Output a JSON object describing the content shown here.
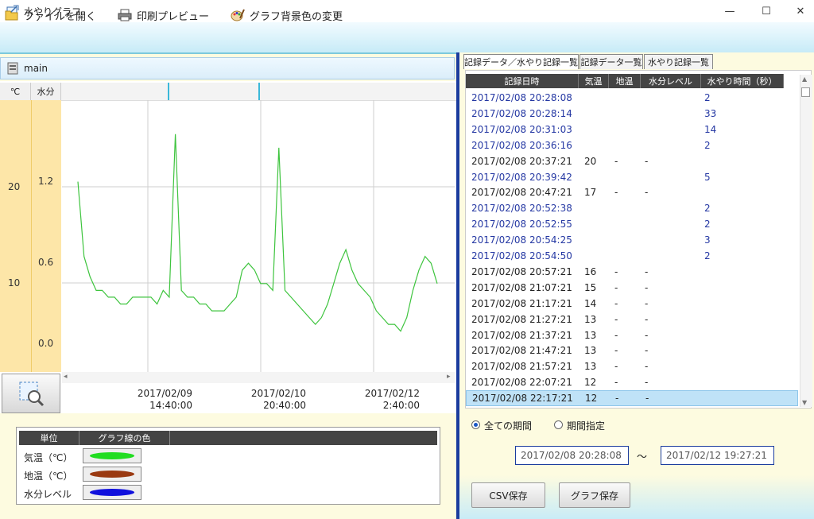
{
  "window": {
    "title": "水やりグラフ",
    "minimize": "—",
    "maximize": "☐",
    "close": "✕"
  },
  "toolbar": {
    "open_file": "ファイルを開く",
    "print_preview": "印刷プレビュー",
    "bg_color": "グラフ背景色の変更"
  },
  "left": {
    "panel_title": "main",
    "col_temp": "℃",
    "col_water": "水分"
  },
  "chart_data": {
    "type": "line",
    "y_temp_ticks": [
      "20",
      "10"
    ],
    "y_water_ticks": [
      "1.2",
      "0.6",
      "0.0"
    ],
    "x_ticks": [
      {
        "date": "2017/02/09",
        "time": "14:40:00"
      },
      {
        "date": "2017/02/10",
        "time": "20:40:00"
      },
      {
        "date": "2017/02/12",
        "time": "2:40:00"
      }
    ],
    "ylim_water": [
      -0.2,
      1.8
    ],
    "series": [
      {
        "color": "#3ec43e",
        "values": [
          1.2,
          0.65,
          0.5,
          0.4,
          0.4,
          0.35,
          0.35,
          0.3,
          0.3,
          0.35,
          0.35,
          0.35,
          0.35,
          0.3,
          0.4,
          0.35,
          1.55,
          0.4,
          0.35,
          0.35,
          0.3,
          0.3,
          0.25,
          0.25,
          0.25,
          0.3,
          0.35,
          0.55,
          0.6,
          0.55,
          0.45,
          0.45,
          0.4,
          1.45,
          0.4,
          0.35,
          0.3,
          0.25,
          0.2,
          0.15,
          0.2,
          0.3,
          0.45,
          0.6,
          0.7,
          0.55,
          0.45,
          0.4,
          0.35,
          0.25,
          0.2,
          0.15,
          0.15,
          0.1,
          0.2,
          0.4,
          0.55,
          0.65,
          0.6,
          0.45
        ]
      }
    ]
  },
  "legend": {
    "head_unit": "単位",
    "head_color": "グラフ線の色",
    "rows": [
      {
        "label": "気温（℃）",
        "color": "#22dd22"
      },
      {
        "label": "地温（℃）",
        "color": "#9a3a12"
      },
      {
        "label": "水分レベル",
        "color": "#1111dd"
      }
    ]
  },
  "right": {
    "tabs": [
      "記録データ／水やり記録一覧",
      "記録データ一覧",
      "水やり記録一覧"
    ],
    "headers": [
      "記録日時",
      "気温",
      "地温",
      "水分レベル",
      "水やり時間（秒）"
    ],
    "rows": [
      {
        "datetime": "2017/02/08 20:28:08",
        "temp": "",
        "soil": "",
        "level": "",
        "water": "2",
        "type": "water"
      },
      {
        "datetime": "2017/02/08 20:28:14",
        "temp": "",
        "soil": "",
        "level": "",
        "water": "33",
        "type": "water"
      },
      {
        "datetime": "2017/02/08 20:31:03",
        "temp": "",
        "soil": "",
        "level": "",
        "water": "14",
        "type": "water"
      },
      {
        "datetime": "2017/02/08 20:36:16",
        "temp": "",
        "soil": "",
        "level": "",
        "water": "2",
        "type": "water"
      },
      {
        "datetime": "2017/02/08 20:37:21",
        "temp": "20",
        "soil": "-",
        "level": "-",
        "water": "",
        "type": "record"
      },
      {
        "datetime": "2017/02/08 20:39:42",
        "temp": "",
        "soil": "",
        "level": "",
        "water": "5",
        "type": "water"
      },
      {
        "datetime": "2017/02/08 20:47:21",
        "temp": "17",
        "soil": "-",
        "level": "-",
        "water": "",
        "type": "record"
      },
      {
        "datetime": "2017/02/08 20:52:38",
        "temp": "",
        "soil": "",
        "level": "",
        "water": "2",
        "type": "water"
      },
      {
        "datetime": "2017/02/08 20:52:55",
        "temp": "",
        "soil": "",
        "level": "",
        "water": "2",
        "type": "water"
      },
      {
        "datetime": "2017/02/08 20:54:25",
        "temp": "",
        "soil": "",
        "level": "",
        "water": "3",
        "type": "water"
      },
      {
        "datetime": "2017/02/08 20:54:50",
        "temp": "",
        "soil": "",
        "level": "",
        "water": "2",
        "type": "water"
      },
      {
        "datetime": "2017/02/08 20:57:21",
        "temp": "16",
        "soil": "-",
        "level": "-",
        "water": "",
        "type": "record"
      },
      {
        "datetime": "2017/02/08 21:07:21",
        "temp": "15",
        "soil": "-",
        "level": "-",
        "water": "",
        "type": "record"
      },
      {
        "datetime": "2017/02/08 21:17:21",
        "temp": "14",
        "soil": "-",
        "level": "-",
        "water": "",
        "type": "record"
      },
      {
        "datetime": "2017/02/08 21:27:21",
        "temp": "13",
        "soil": "-",
        "level": "-",
        "water": "",
        "type": "record"
      },
      {
        "datetime": "2017/02/08 21:37:21",
        "temp": "13",
        "soil": "-",
        "level": "-",
        "water": "",
        "type": "record"
      },
      {
        "datetime": "2017/02/08 21:47:21",
        "temp": "13",
        "soil": "-",
        "level": "-",
        "water": "",
        "type": "record"
      },
      {
        "datetime": "2017/02/08 21:57:21",
        "temp": "13",
        "soil": "-",
        "level": "-",
        "water": "",
        "type": "record"
      },
      {
        "datetime": "2017/02/08 22:07:21",
        "temp": "12",
        "soil": "-",
        "level": "-",
        "water": "",
        "type": "record"
      },
      {
        "datetime": "2017/02/08 22:17:21",
        "temp": "12",
        "soil": "-",
        "level": "-",
        "water": "",
        "type": "selected"
      }
    ],
    "radio_all": "全ての期間",
    "radio_range": "期間指定",
    "date_from": "2017/02/08 20:28:08",
    "tilde": "〜",
    "date_to": "2017/02/12 19:27:21",
    "csv_button": "CSV保存",
    "graph_button": "グラフ保存"
  }
}
